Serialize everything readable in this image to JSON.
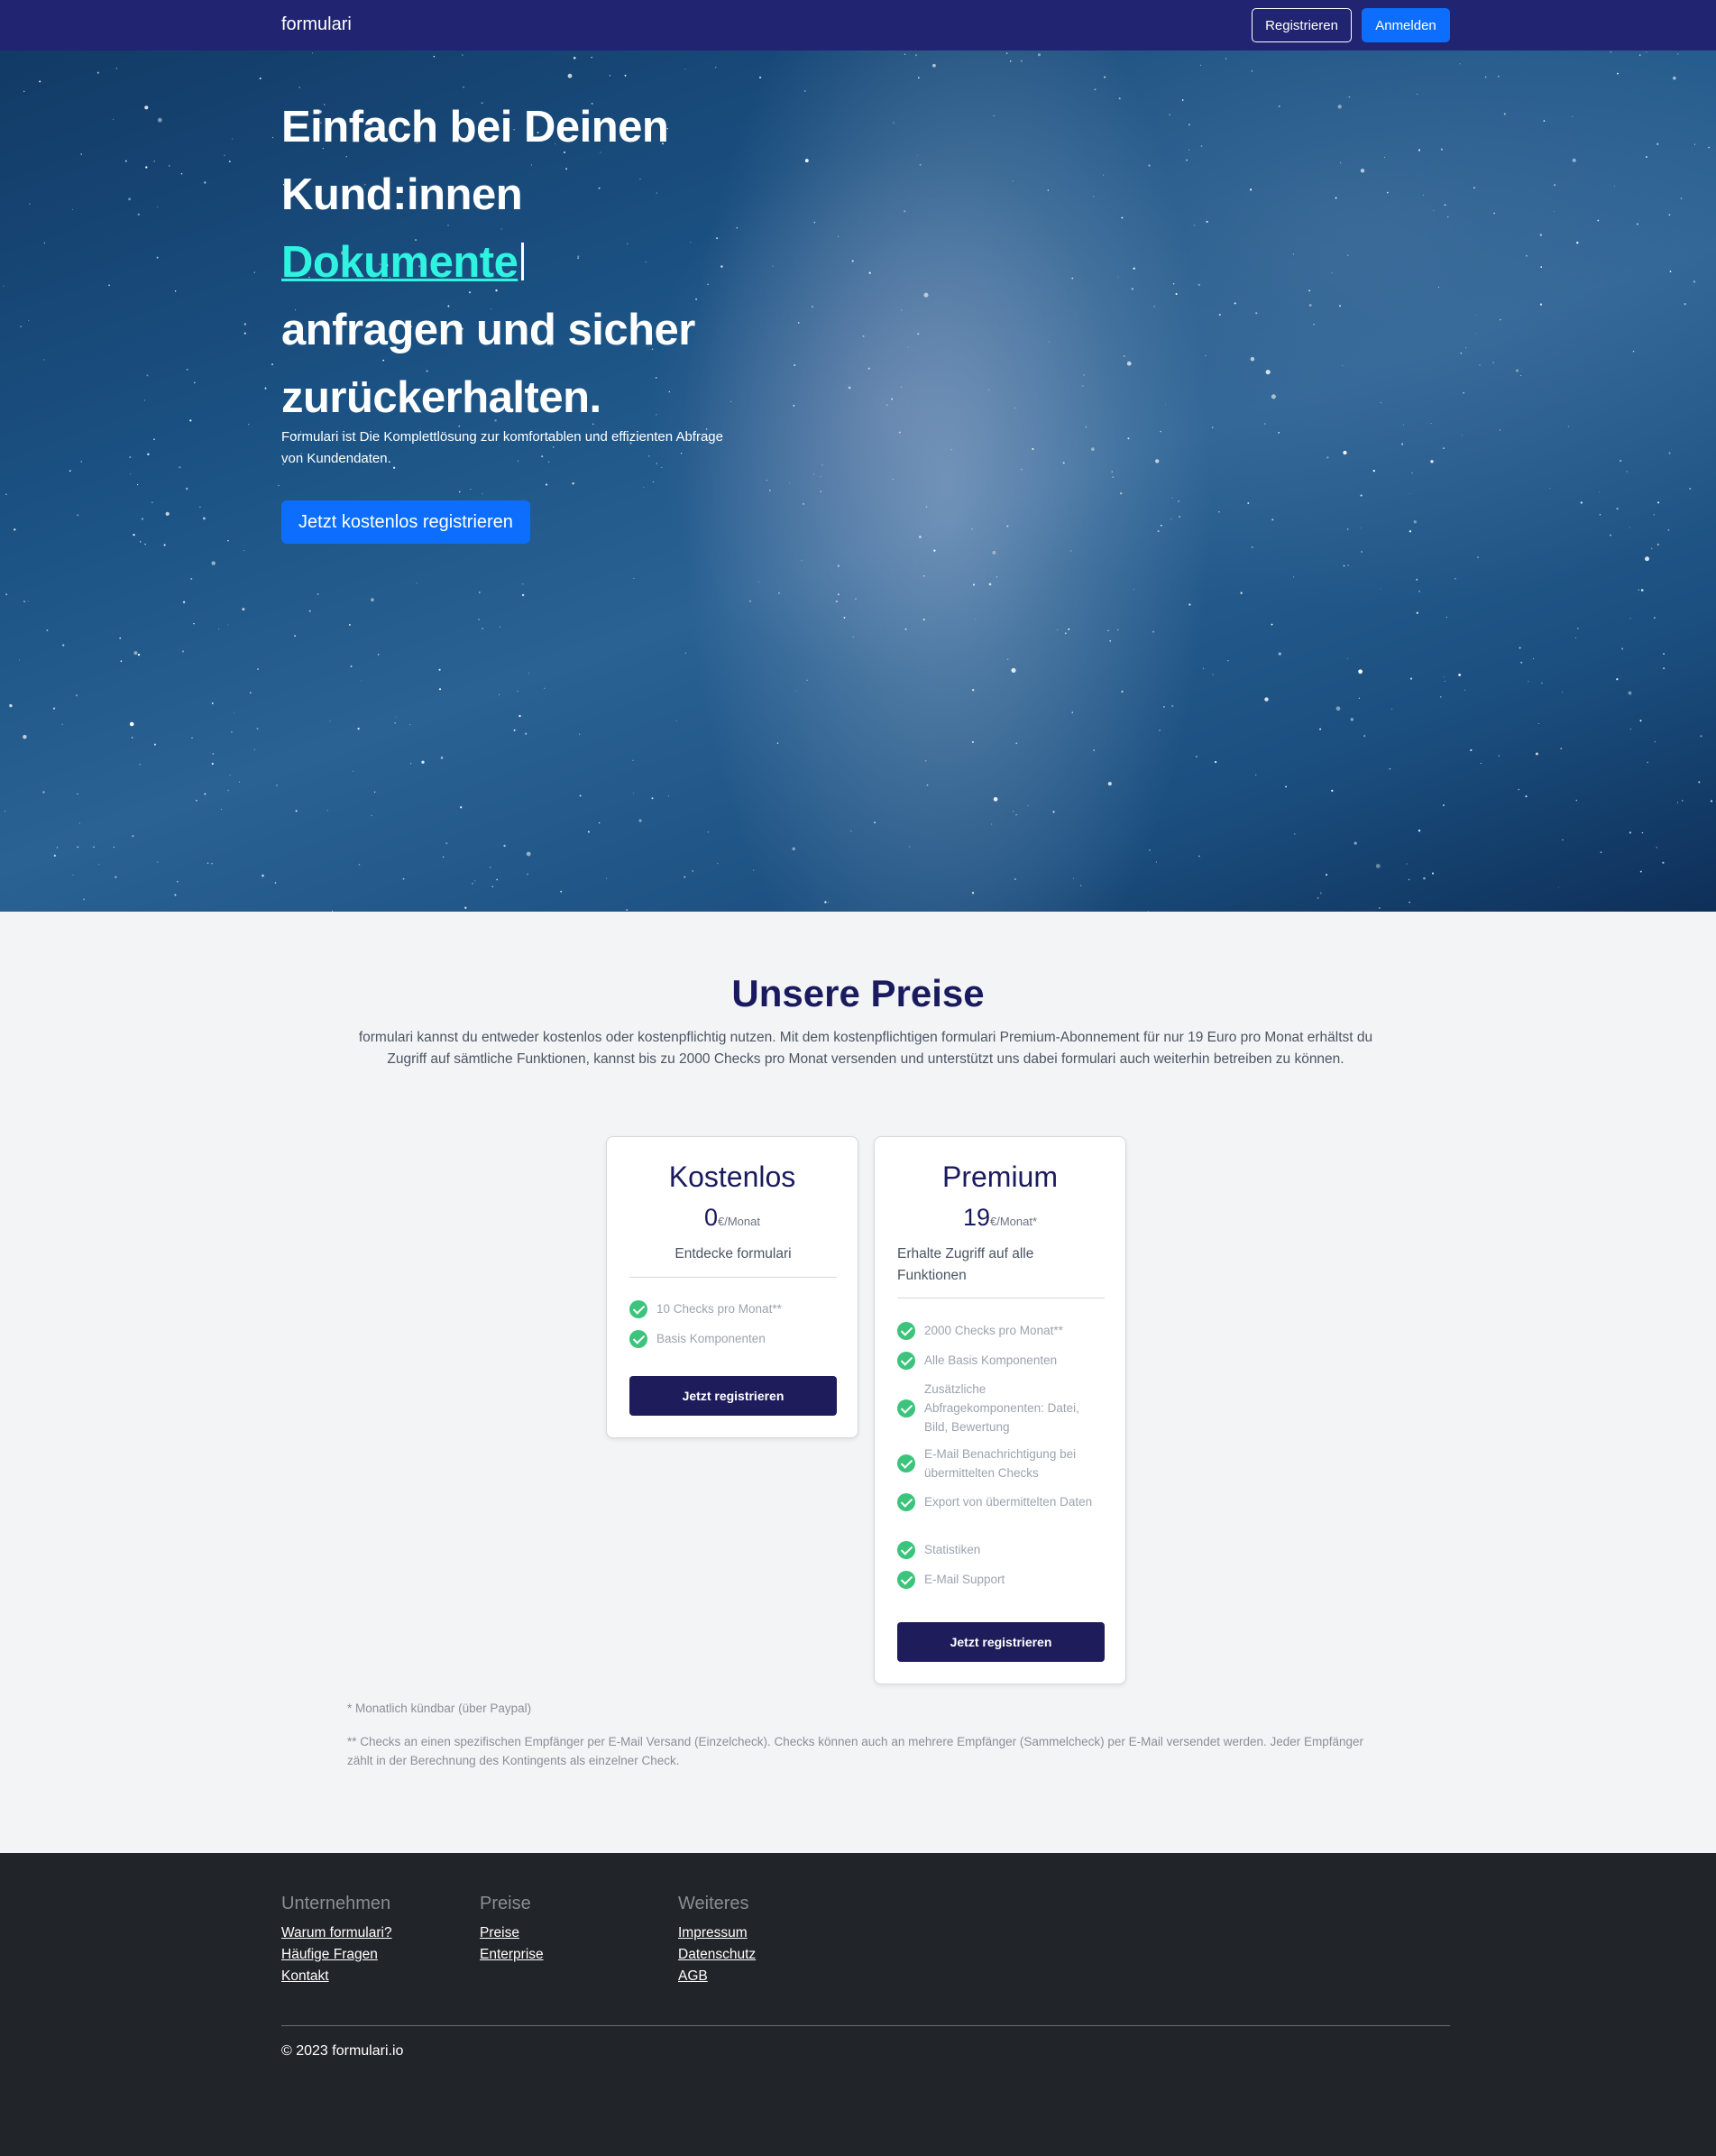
{
  "navbar": {
    "brand": "formulari",
    "register_label": "Registrieren",
    "login_label": "Anmelden"
  },
  "hero": {
    "title_line1": "Einfach bei Deinen",
    "title_line2": "Kund:innen",
    "title_accent": "Dokumente",
    "title_line4": "anfragen und sicher",
    "title_line5": "zurückerhalten.",
    "subtitle": "Formulari ist Die Komplettlösung zur komfortablen und effizienten Abfrage von Kundendaten.",
    "cta_label": "Jetzt kostenlos registrieren"
  },
  "pricing": {
    "title": "Unsere Preise",
    "description": "formulari kannst du entweder kostenlos oder kostenpflichtig nutzen. Mit dem kostenpflichtigen formulari Premium-Abonnement für nur 19 Euro pro Monat erhältst du Zugriff auf sämtliche Funktionen, kannst bis zu 2000 Checks pro Monat versenden und unterstützt uns dabei formulari auch weiterhin betreiben zu können.",
    "plans": [
      {
        "name": "Kostenlos",
        "price": "0",
        "unit": "€/Monat",
        "tagline": "Entdecke formulari",
        "features": [
          "10 Checks pro Monat**",
          "Basis Komponenten"
        ],
        "button_label": "Jetzt registrieren"
      },
      {
        "name": "Premium",
        "price": "19",
        "unit": "€/Monat*",
        "tagline": "Erhalte Zugriff auf alle Funktionen",
        "features": [
          "2000 Checks pro Monat**",
          "Alle Basis Komponenten",
          "Zusätzliche Abfragekomponenten: Datei, Bild, Bewertung",
          "E-Mail Benachrichtigung bei übermittelten Checks",
          "Export von übermittelten Daten",
          "Statistiken",
          "E-Mail Support"
        ],
        "button_label": "Jetzt registrieren"
      }
    ],
    "footnote1": "* Monatlich kündbar (über Paypal)",
    "footnote2": "** Checks an einen spezifischen Empfänger per E-Mail Versand (Einzelcheck). Checks können auch an mehrere Empfänger (Sammelcheck) per E-Mail versendet werden. Jeder Empfänger zählt in der Berechnung des Kontingents als einzelner Check."
  },
  "footer": {
    "columns": [
      {
        "heading": "Unternehmen",
        "links": [
          "Warum formulari?",
          "Häufige Fragen",
          "Kontakt"
        ]
      },
      {
        "heading": "Preise",
        "links": [
          "Preise",
          "Enterprise"
        ]
      },
      {
        "heading": "Weiteres",
        "links": [
          "Impressum",
          "Datenschutz",
          "AGB"
        ]
      }
    ],
    "copyright": "© 2023 formulari.io"
  },
  "colors": {
    "navbar_bg": "#212470",
    "primary": "#0d6efd",
    "accent": "#2ff3e0",
    "heading": "#1a1b5e",
    "card_button": "#1f1c5c",
    "check": "#3cc47c",
    "footer_bg": "#212428"
  }
}
